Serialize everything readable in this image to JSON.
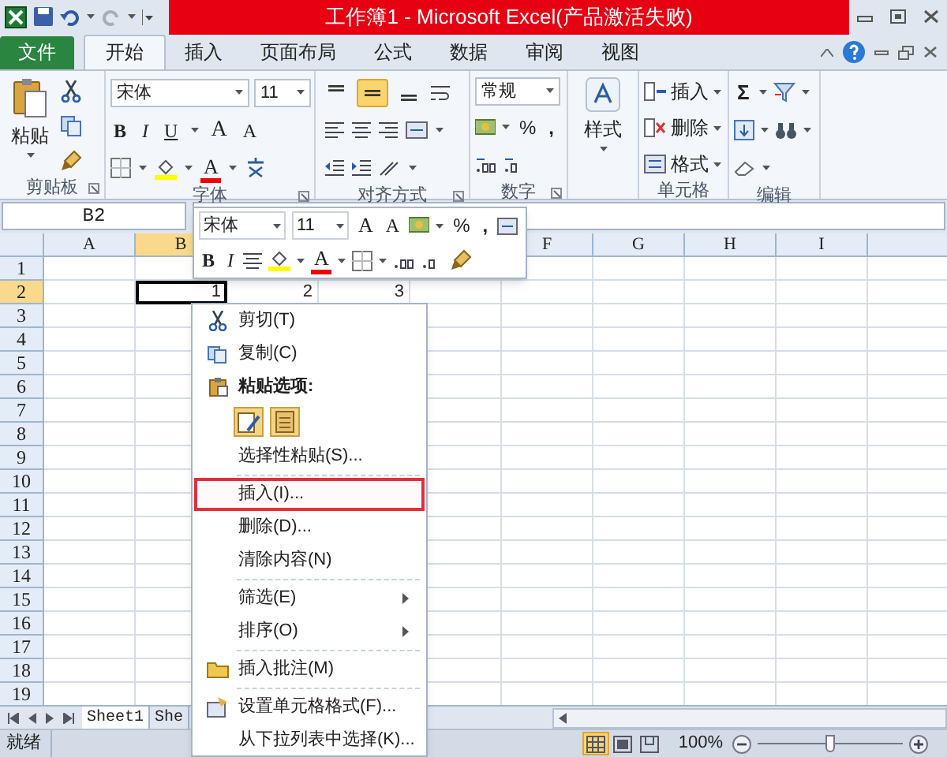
{
  "window": {
    "title": "工作簿1 - Microsoft Excel(产品激活失败)"
  },
  "ribbon_tabs": [
    {
      "label": "文件",
      "kind": "file"
    },
    {
      "label": "开始",
      "kind": "tab",
      "selected": true
    },
    {
      "label": "插入",
      "kind": "tab",
      "selected": false
    },
    {
      "label": "页面布局",
      "kind": "tab",
      "selected": false
    },
    {
      "label": "公式",
      "kind": "tab",
      "selected": false
    },
    {
      "label": "数据",
      "kind": "tab",
      "selected": false
    },
    {
      "label": "审阅",
      "kind": "tab",
      "selected": false
    },
    {
      "label": "视图",
      "kind": "tab",
      "selected": false
    }
  ],
  "clipboard": {
    "paste": "粘贴",
    "group_label": "剪贴板"
  },
  "font": {
    "name": "宋体",
    "size": "11",
    "bold": "B",
    "italic": "I",
    "underline": "U",
    "grow": "A",
    "shrink": "A",
    "font_color": "A",
    "group_label": "字体"
  },
  "alignment": {
    "vertical": [
      {
        "selected": false
      },
      {
        "selected": true
      },
      {
        "selected": false
      }
    ],
    "group_label": "对齐方式"
  },
  "number": {
    "format": "常规",
    "percent": "%",
    "comma": ",",
    "group_label": "数字"
  },
  "styles": {
    "button": "样式"
  },
  "cells": {
    "buttons": [
      "插入",
      "删除",
      "格式"
    ],
    "group_label": "单元格"
  },
  "editing": {
    "sum": "Σ",
    "group_label": "编辑"
  },
  "name_box": "B2",
  "mini_toolbar": {
    "font": "宋体",
    "size": "11",
    "grow": "A",
    "shrink": "A",
    "percent": "%",
    "comma": ",",
    "bold": "B",
    "italic": "I",
    "font_color": "A"
  },
  "columns": [
    {
      "label": "A",
      "selected": false
    },
    {
      "label": "B",
      "selected": true
    },
    {},
    {},
    {},
    {
      "label": "F",
      "selected": false
    },
    {
      "label": "G",
      "selected": false
    },
    {
      "label": "H",
      "selected": false
    },
    {
      "label": "I",
      "selected": false
    }
  ],
  "rows": [
    {
      "label": "1",
      "selected": false,
      "cells": []
    },
    {
      "label": "2",
      "selected": true,
      "cells": [
        null,
        {
          "value": "1",
          "active": true
        },
        {
          "value": "2",
          "active": false
        },
        {
          "value": "3",
          "active": false
        }
      ]
    },
    {
      "label": "3",
      "selected": false,
      "cells": []
    },
    {
      "label": "4",
      "selected": false,
      "cells": []
    },
    {
      "label": "5",
      "selected": false,
      "cells": []
    },
    {
      "label": "6",
      "selected": false,
      "cells": []
    },
    {
      "label": "7",
      "selected": false,
      "cells": []
    },
    {
      "label": "8",
      "selected": false,
      "cells": []
    },
    {
      "label": "9",
      "selected": false,
      "cells": []
    },
    {
      "label": "10",
      "selected": false,
      "cells": []
    },
    {
      "label": "11",
      "selected": false,
      "cells": []
    },
    {
      "label": "12",
      "selected": false,
      "cells": []
    },
    {
      "label": "13",
      "selected": false,
      "cells": []
    },
    {
      "label": "14",
      "selected": false,
      "cells": []
    },
    {
      "label": "15",
      "selected": false,
      "cells": []
    },
    {
      "label": "16",
      "selected": false,
      "cells": []
    },
    {
      "label": "17",
      "selected": false,
      "cells": []
    },
    {
      "label": "18",
      "selected": false,
      "cells": []
    },
    {
      "label": "19",
      "selected": false,
      "cells": []
    }
  ],
  "sheet_tabs": [
    {
      "label": "Sheet1",
      "selected": true
    },
    {
      "label": "She",
      "selected": false
    }
  ],
  "context_menu": [
    {
      "kind": "cut",
      "label": "剪切(T)",
      "highlighted": false
    },
    {
      "kind": "copy",
      "label": "复制(C)",
      "highlighted": false
    },
    {
      "kind": "paste_options",
      "label": "粘贴选项:",
      "highlighted": false
    },
    {
      "kind": "paste_buttons"
    },
    {
      "kind": "plain",
      "label": "选择性粘贴(S)...",
      "highlighted": false
    },
    {
      "kind": "separator"
    },
    {
      "kind": "plain",
      "label": "插入(I)...",
      "highlighted": true
    },
    {
      "kind": "plain",
      "label": "删除(D)...",
      "highlighted": false
    },
    {
      "kind": "plain",
      "label": "清除内容(N)",
      "highlighted": false
    },
    {
      "kind": "separator"
    },
    {
      "kind": "submenu",
      "label": "筛选(E)",
      "highlighted": false
    },
    {
      "kind": "submenu",
      "label": "排序(O)",
      "highlighted": false
    },
    {
      "kind": "separator"
    },
    {
      "kind": "comment",
      "label": "插入批注(M)",
      "highlighted": false
    },
    {
      "kind": "separator"
    },
    {
      "kind": "format_cells",
      "label": "设置单元格格式(F)...",
      "highlighted": false
    },
    {
      "kind": "plain",
      "label": "从下拉列表中选择(K)...",
      "highlighted": false
    }
  ],
  "status_bar": {
    "status": "就绪",
    "views": [
      {
        "selected": true
      },
      {
        "selected": false
      },
      {
        "selected": false
      }
    ],
    "zoom": "100%",
    "zoom_slider": {
      "level": 0.5
    }
  }
}
